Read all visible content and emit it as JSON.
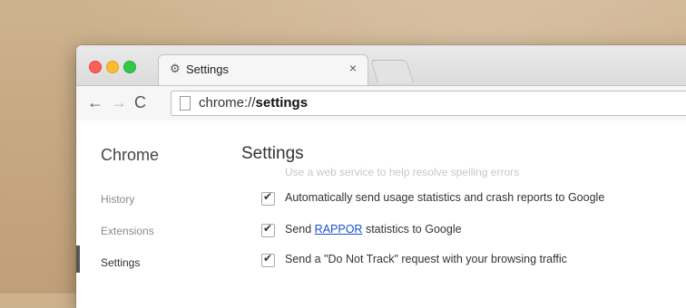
{
  "tab": {
    "title": "Settings",
    "close": "×"
  },
  "nav": {
    "back": "←",
    "forward": "→",
    "reload": "C"
  },
  "address": {
    "scheme": "chrome://",
    "host": "settings"
  },
  "sidebar": {
    "title": "Chrome",
    "items": [
      {
        "label": "History"
      },
      {
        "label": "Extensions"
      },
      {
        "label": "Settings"
      }
    ]
  },
  "main": {
    "title": "Settings",
    "ghost_text": "Use a web service to help resolve spelling errors",
    "options": [
      {
        "text": "Automatically send usage statistics and crash reports to Google",
        "checked": true
      },
      {
        "pre": "Send ",
        "link": "RAPPOR",
        "post": " statistics to Google",
        "checked": true
      },
      {
        "text": "Send a \"Do Not Track\" request with your browsing traffic",
        "checked": true
      }
    ]
  }
}
